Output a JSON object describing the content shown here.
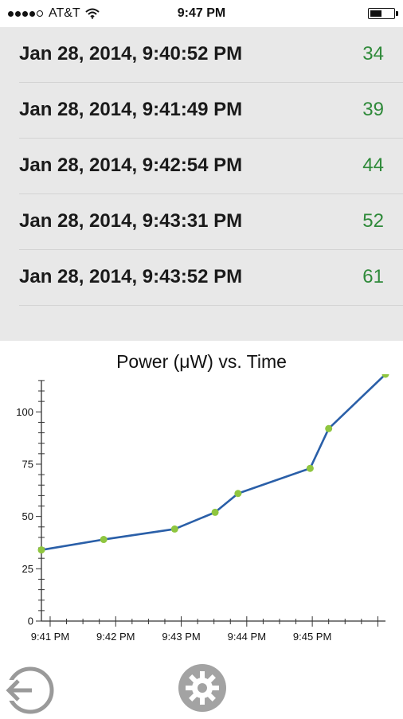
{
  "status_bar": {
    "carrier": "AT&T",
    "time": "9:47 PM"
  },
  "readings": [
    {
      "date": "Jan 28, 2014, 9:40:52 PM",
      "value": "34"
    },
    {
      "date": "Jan 28, 2014, 9:41:49 PM",
      "value": "39"
    },
    {
      "date": "Jan 28, 2014, 9:42:54 PM",
      "value": "44"
    },
    {
      "date": "Jan 28, 2014, 9:43:31 PM",
      "value": "52"
    },
    {
      "date": "Jan 28, 2014, 9:43:52 PM",
      "value": "61"
    }
  ],
  "colors": {
    "line": "#2a5fa8",
    "point": "#8fc63f",
    "value_text": "#2f8a3a",
    "list_bg": "#e8e8e8"
  },
  "icons": {
    "back": "back-arrow-icon",
    "settings": "gear-icon"
  },
  "chart_data": {
    "type": "line",
    "title": "Power (μW) vs. Time",
    "xlabel": "",
    "ylabel": "",
    "x_ticks": [
      "9:41 PM",
      "9:42 PM",
      "9:43 PM",
      "9:44 PM",
      "9:45 PM"
    ],
    "y_ticks": [
      "0",
      "25",
      "50",
      "75",
      "100"
    ],
    "xlim": [
      "9:40:52 PM",
      "9:46:07 PM"
    ],
    "ylim": [
      0,
      118
    ],
    "grid": false,
    "series": [
      {
        "points": [
          {
            "x": "9:40:52 PM",
            "y": 34
          },
          {
            "x": "9:41:49 PM",
            "y": 39
          },
          {
            "x": "9:42:54 PM",
            "y": 44
          },
          {
            "x": "9:43:31 PM",
            "y": 52
          },
          {
            "x": "9:43:52 PM",
            "y": 61
          },
          {
            "x": "9:44:58 PM",
            "y": 73
          },
          {
            "x": "9:45:15 PM",
            "y": 92
          },
          {
            "x": "9:46:07 PM",
            "y": 118
          }
        ]
      }
    ]
  }
}
